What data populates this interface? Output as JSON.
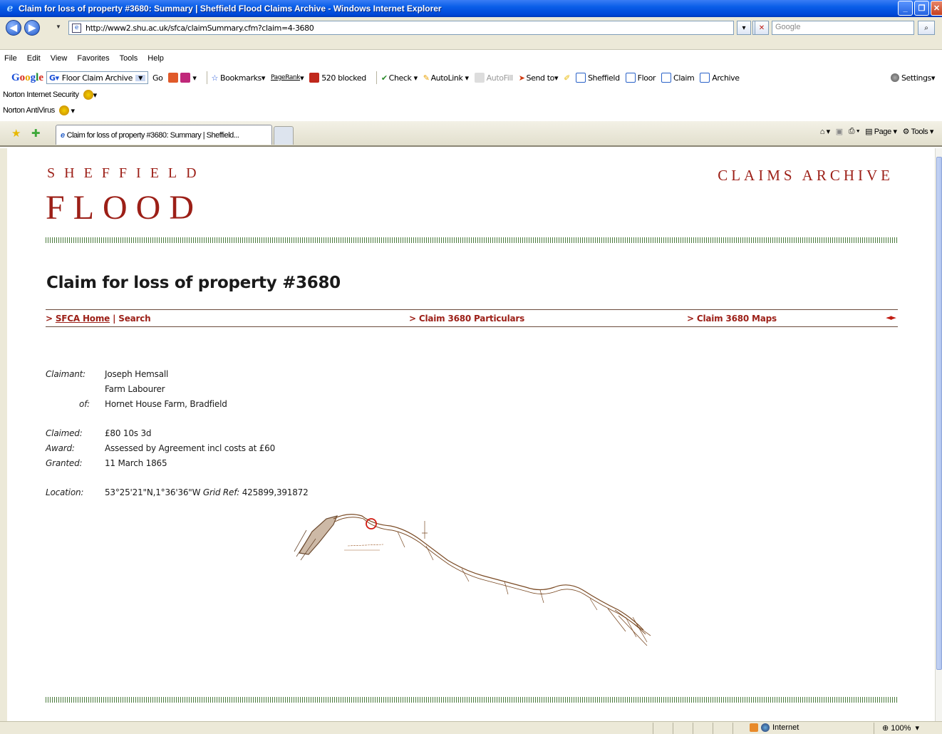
{
  "window": {
    "title": "Claim for loss of property #3680: Summary | Sheffield Flood Claims Archive - Windows Internet Explorer"
  },
  "address": {
    "url": "http://www2.shu.ac.uk/sfca/claimSummary.cfm?claim=4-3680",
    "search_placeholder": "Google"
  },
  "menu": [
    "File",
    "Edit",
    "View",
    "Favorites",
    "Tools",
    "Help"
  ],
  "google_toolbar": {
    "search_value": "Floor Claim Archive",
    "go": "Go",
    "bookmarks": "Bookmarks",
    "pagerank": "PageRank",
    "popups": "520 blocked",
    "check": "Check",
    "autolink": "AutoLink",
    "autofill": "AutoFill",
    "sendto": "Send to",
    "terms": [
      "Sheffield",
      "Floor",
      "Claim",
      "Archive"
    ],
    "settings": "Settings"
  },
  "norton": {
    "security": "Norton Internet Security",
    "antivirus": "Norton AntiVirus"
  },
  "tab": {
    "title": "Claim for loss of property #3680: Summary | Sheffield..."
  },
  "commandbar": {
    "page": "Page",
    "tools": "Tools"
  },
  "site": {
    "sheffield": "SHEFFIELD",
    "flood": "FLOOD",
    "claims_archive": "CLAIMS ARCHIVE"
  },
  "page": {
    "title": "Claim for loss of property #3680",
    "nav": {
      "prefix": ">",
      "home": "SFCA Home",
      "sep": "|",
      "search": "Search",
      "particulars": "> Claim 3680 Particulars",
      "maps": "> Claim 3680 Maps",
      "arrows": "◄►"
    },
    "details": {
      "claimant_label": "Claimant:",
      "claimant_name": "Joseph Hemsall",
      "occupation": "Farm Labourer",
      "of_label": "of:",
      "address": "Hornet House Farm, Bradfield",
      "claimed_label": "Claimed:",
      "claimed": "£80 10s 3d",
      "award_label": "Award:",
      "award": "Assessed by Agreement incl costs at £60",
      "granted_label": "Granted:",
      "granted": "11 March 1865",
      "location_label": "Location:",
      "location": "53°25'21\"N,1°36'36\"W",
      "gridref_label": "Grid Ref:",
      "gridref": "425899,391872"
    }
  },
  "status": {
    "zone": "Internet",
    "zoom": "100%"
  },
  "colors": {
    "brand_red": "#9c1f17",
    "rule_green": "#4a7a3c",
    "xp_blue": "#0a5ee8"
  }
}
